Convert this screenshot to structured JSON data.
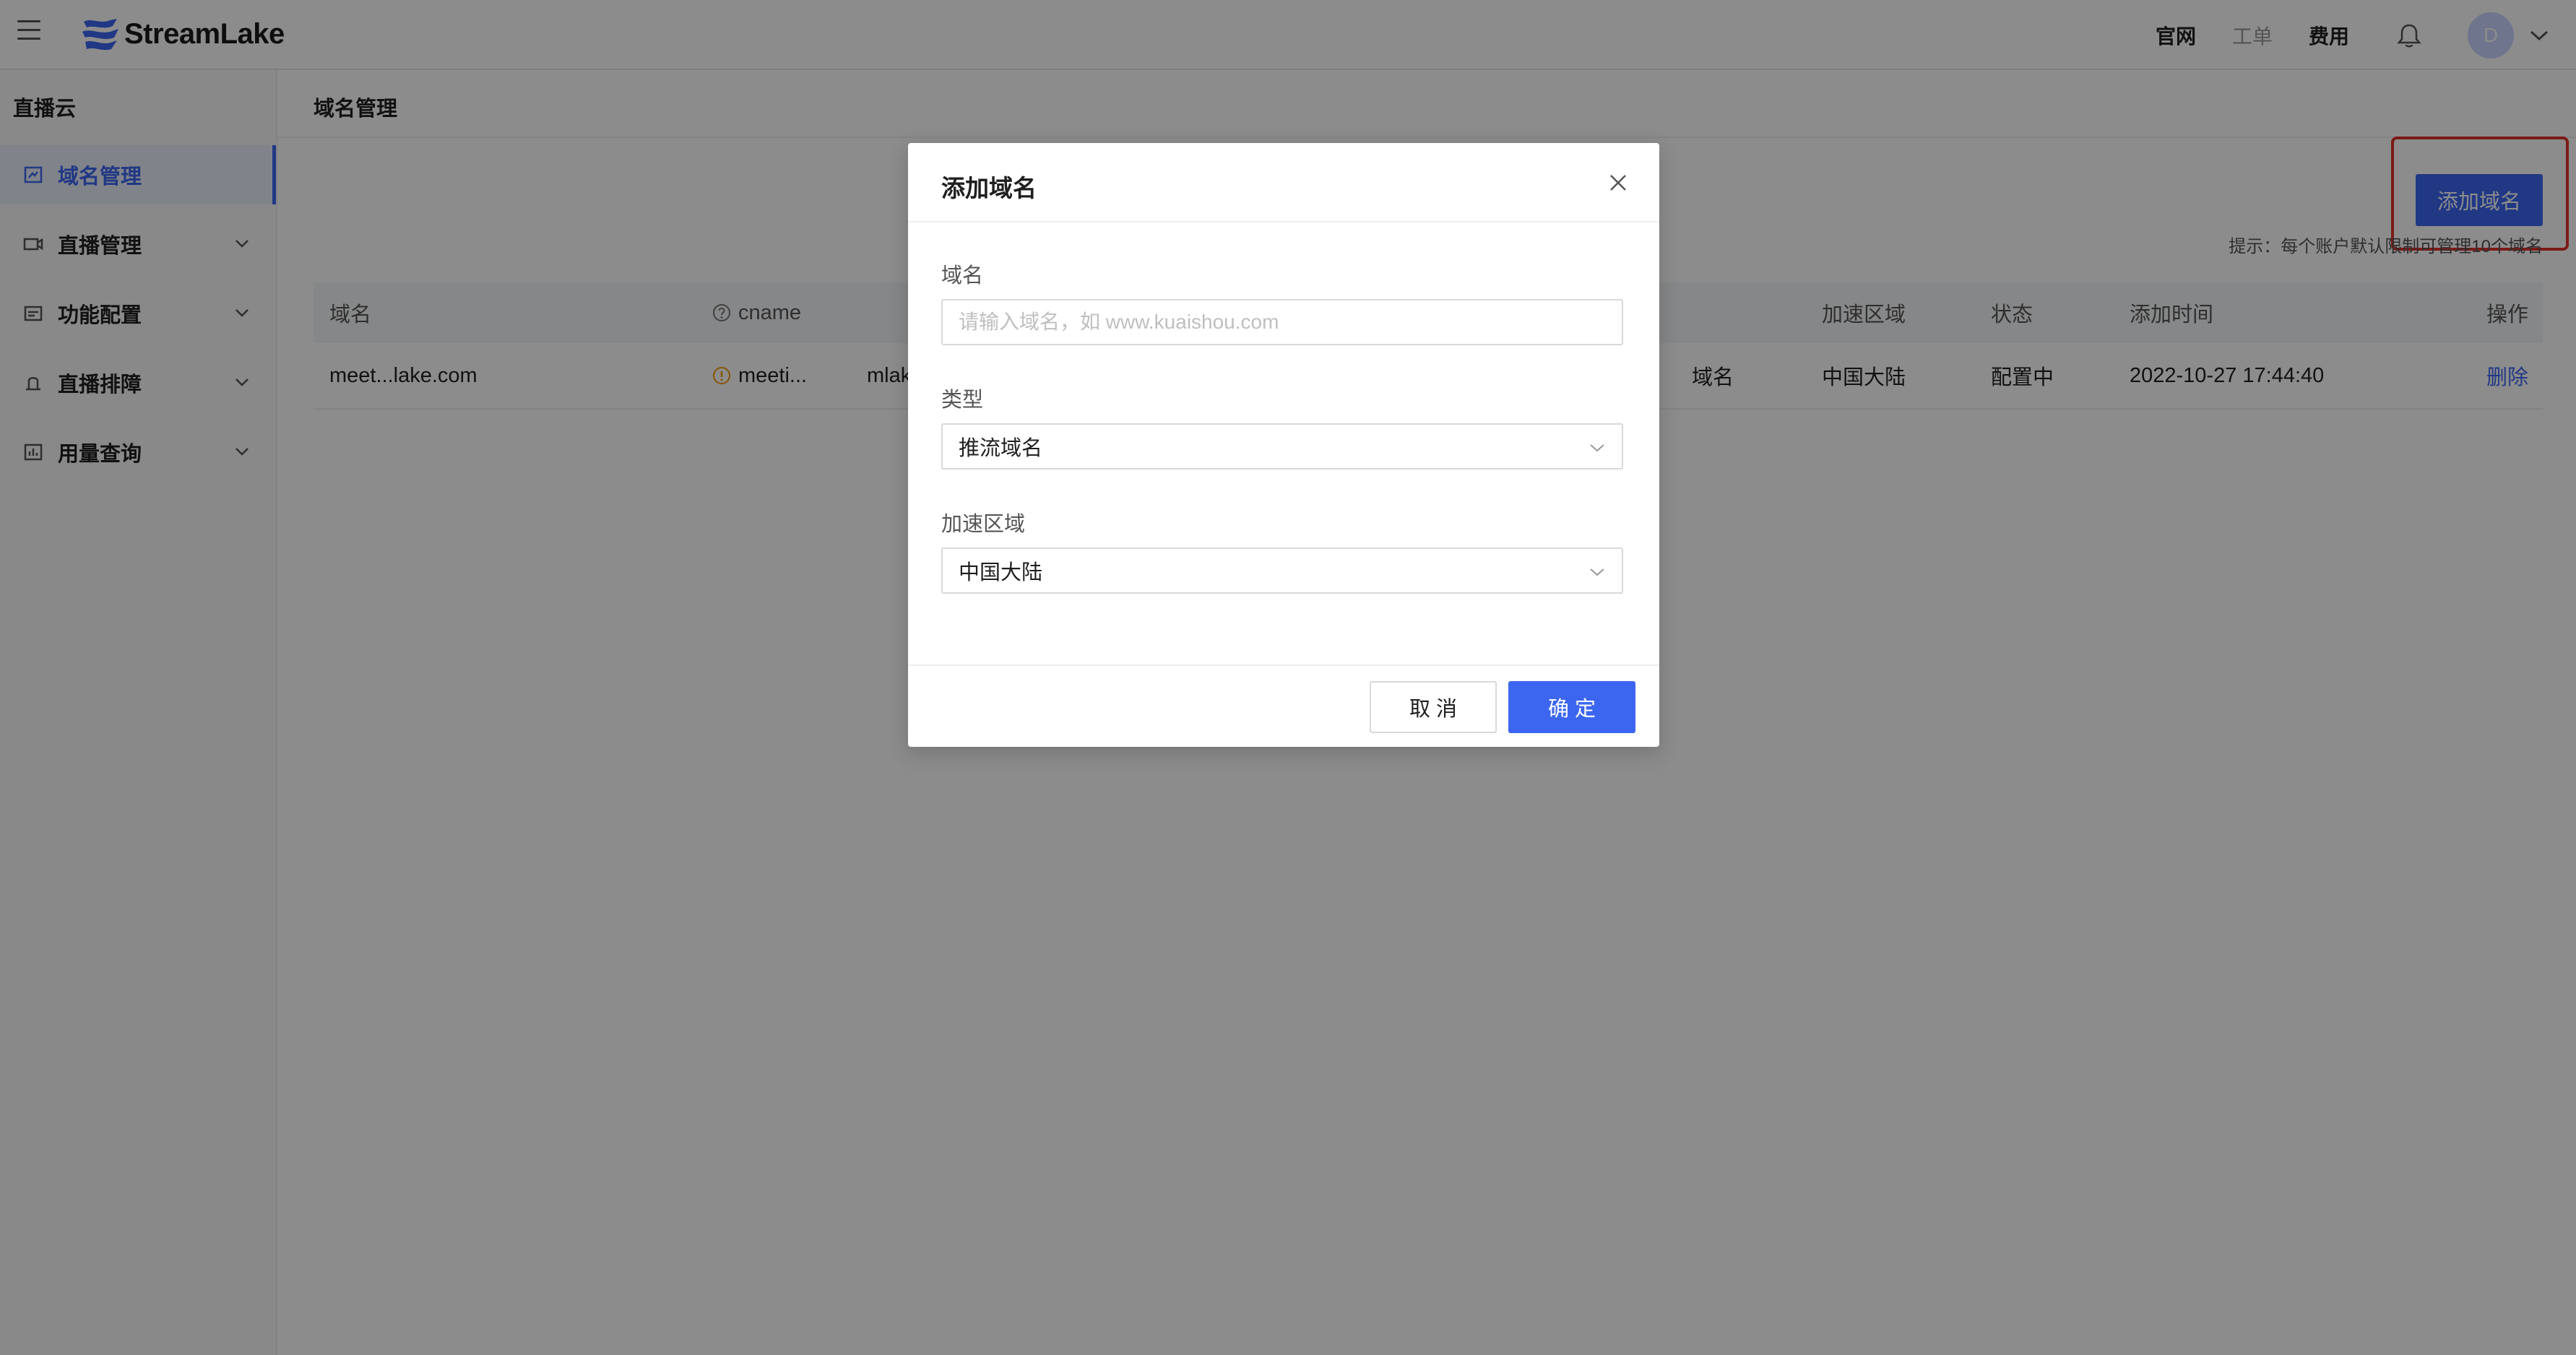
{
  "header": {
    "logo_text": "StreamLake",
    "links": [
      "官网",
      "工单",
      "费用"
    ],
    "avatar_initial": "D",
    "brand_color": "#3c66f0"
  },
  "sidebar": {
    "title": "直播云",
    "items": [
      {
        "label": "域名管理",
        "icon": "domain-icon",
        "active": true
      },
      {
        "label": "直播管理",
        "icon": "camera-icon",
        "expandable": true
      },
      {
        "label": "功能配置",
        "icon": "settings-icon",
        "expandable": true
      },
      {
        "label": "直播排障",
        "icon": "troubleshoot-icon",
        "expandable": true
      },
      {
        "label": "用量查询",
        "icon": "usage-icon",
        "expandable": true
      }
    ]
  },
  "main": {
    "title": "域名管理",
    "add_button": "添加域名",
    "hint": "提示：每个账户默认限制可管理10个域名",
    "table": {
      "headers": [
        "域名",
        "cname",
        "加速区域",
        "状态",
        "添加时间",
        "操作"
      ],
      "rows": [
        {
          "domain": "meet...lake.com",
          "cname": "meeti...",
          "cname_suffix": "mlak",
          "type_partial": "域名",
          "region": "中国大陆",
          "status": "配置中",
          "added_at": "2022-10-27 17:44:40",
          "action": "删除"
        }
      ]
    }
  },
  "modal": {
    "title": "添加域名",
    "domain_label": "域名",
    "domain_placeholder": "请输入域名，如 www.kuaishou.com",
    "type_label": "类型",
    "type_value": "推流域名",
    "region_label": "加速区域",
    "region_value": "中国大陆",
    "cancel": "取 消",
    "confirm": "确 定"
  }
}
